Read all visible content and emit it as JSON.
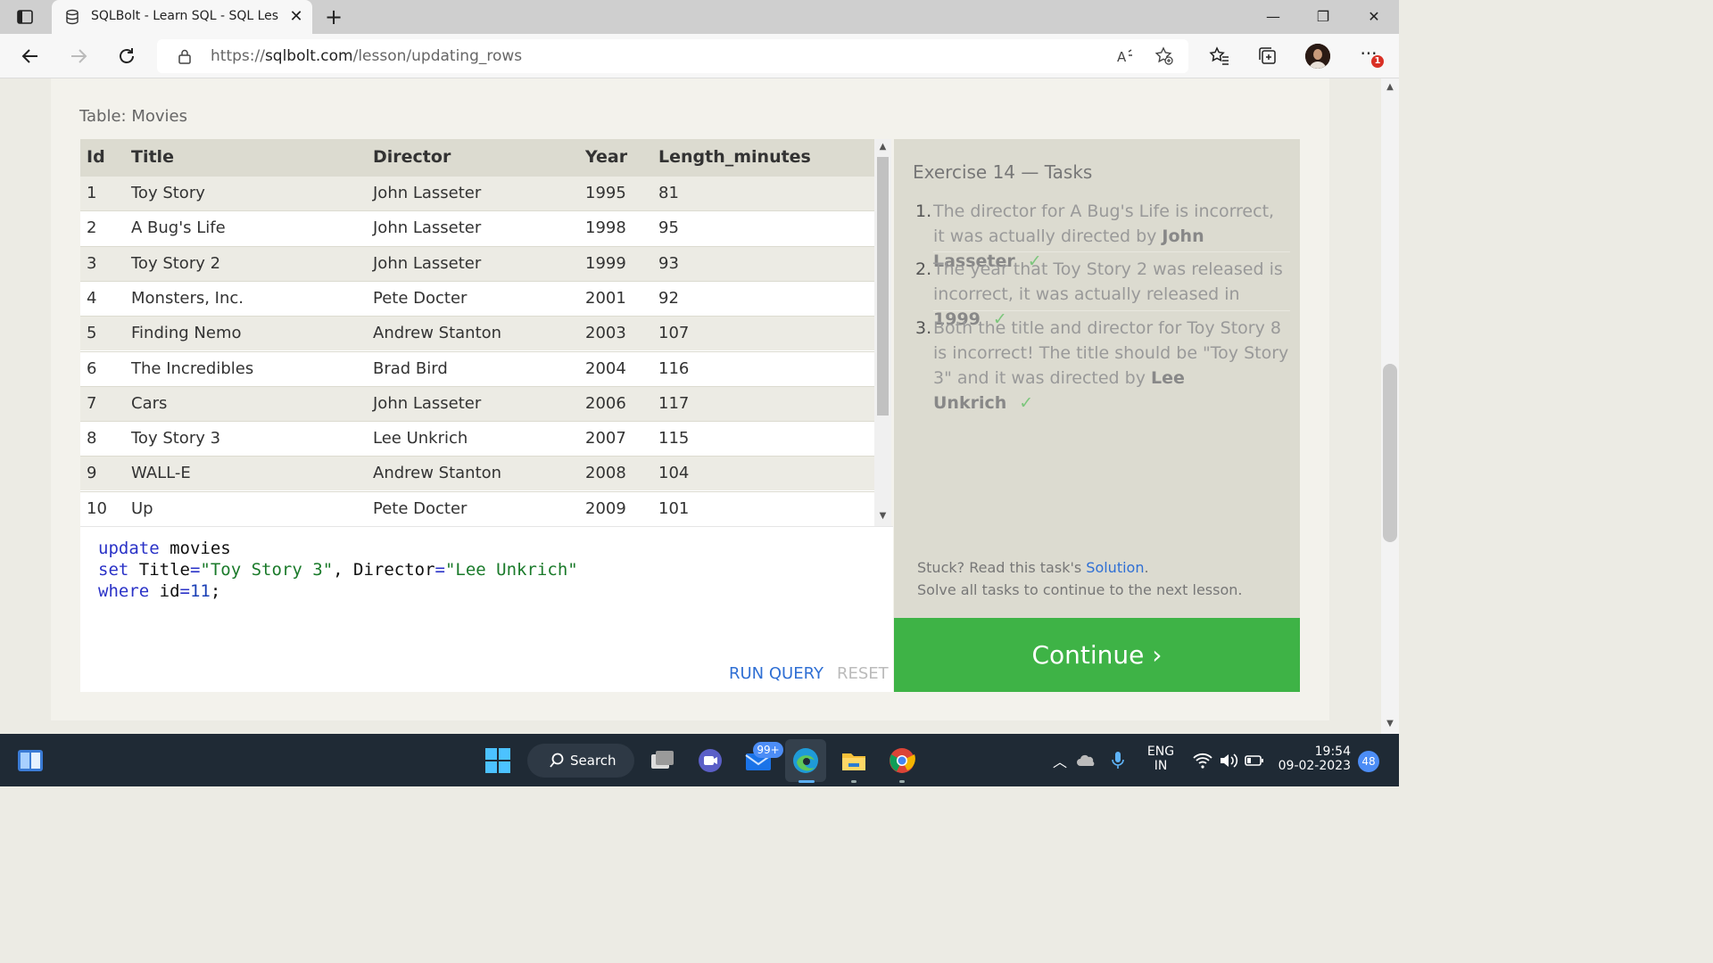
{
  "browser": {
    "tab_title": "SQLBolt - Learn SQL - SQL Lesso",
    "url_prefix": "https://",
    "url_host": "sqlbolt.com",
    "url_path": "/lesson/updating_rows",
    "profile_badge": "1"
  },
  "page": {
    "table_caption": "Table: Movies",
    "table": {
      "headers": [
        "Id",
        "Title",
        "Director",
        "Year",
        "Length_minutes"
      ],
      "rows": [
        [
          "1",
          "Toy Story",
          "John Lasseter",
          "1995",
          "81"
        ],
        [
          "2",
          "A Bug's Life",
          "John Lasseter",
          "1998",
          "95"
        ],
        [
          "3",
          "Toy Story 2",
          "John Lasseter",
          "1999",
          "93"
        ],
        [
          "4",
          "Monsters, Inc.",
          "Pete Docter",
          "2001",
          "92"
        ],
        [
          "5",
          "Finding Nemo",
          "Andrew Stanton",
          "2003",
          "107"
        ],
        [
          "6",
          "The Incredibles",
          "Brad Bird",
          "2004",
          "116"
        ],
        [
          "7",
          "Cars",
          "John Lasseter",
          "2006",
          "117"
        ],
        [
          "8",
          "Toy Story 3",
          "Lee Unkrich",
          "2007",
          "115"
        ],
        [
          "9",
          "WALL-E",
          "Andrew Stanton",
          "2008",
          "104"
        ],
        [
          "10",
          "Up",
          "Pete Docter",
          "2009",
          "101"
        ]
      ]
    },
    "editor": {
      "line1_kw": "update",
      "line1_rest": " movies",
      "line2_kw": "set",
      "line2_a": " Title",
      "line2_eq": "=",
      "line2_str1": "\"Toy Story 3\"",
      "line2_b": ", Director",
      "line2_eq2": "=",
      "line2_str2": "\"Lee Unkrich\"",
      "line3_kw": "where",
      "line3_a": " id",
      "line3_eq": "=",
      "line3_num": "11",
      "line3_end": ";",
      "run_label": "RUN QUERY",
      "reset_label": "RESET"
    },
    "tasks": {
      "title": "Exercise 14 — Tasks",
      "items": [
        {
          "num": "1.",
          "text": "The director for A Bug's Life is incorrect, it was actually directed by ",
          "bold": "John Lasseter",
          "check": "✓"
        },
        {
          "num": "2.",
          "text": "The year that Toy Story 2 was released is incorrect, it was actually released in ",
          "bold": "1999",
          "check": "✓"
        },
        {
          "num": "3.",
          "text": "Both the title and director for Toy Story 8 is incorrect! The title should be \"Toy Story 3\" and it was directed by ",
          "bold": "Lee Unkrich",
          "check": "✓"
        }
      ],
      "stuck_prefix": "Stuck? Read this task's ",
      "stuck_link": "Solution",
      "stuck_suffix": ".",
      "solve_all": "Solve all tasks to continue to the next lesson.",
      "continue_label": "Continue ›"
    }
  },
  "taskbar": {
    "search_label": "Search",
    "mail_badge": "99+",
    "lang_line1": "ENG",
    "lang_line2": "IN",
    "time": "19:54",
    "date": "09-02-2023",
    "notifications": "48"
  }
}
